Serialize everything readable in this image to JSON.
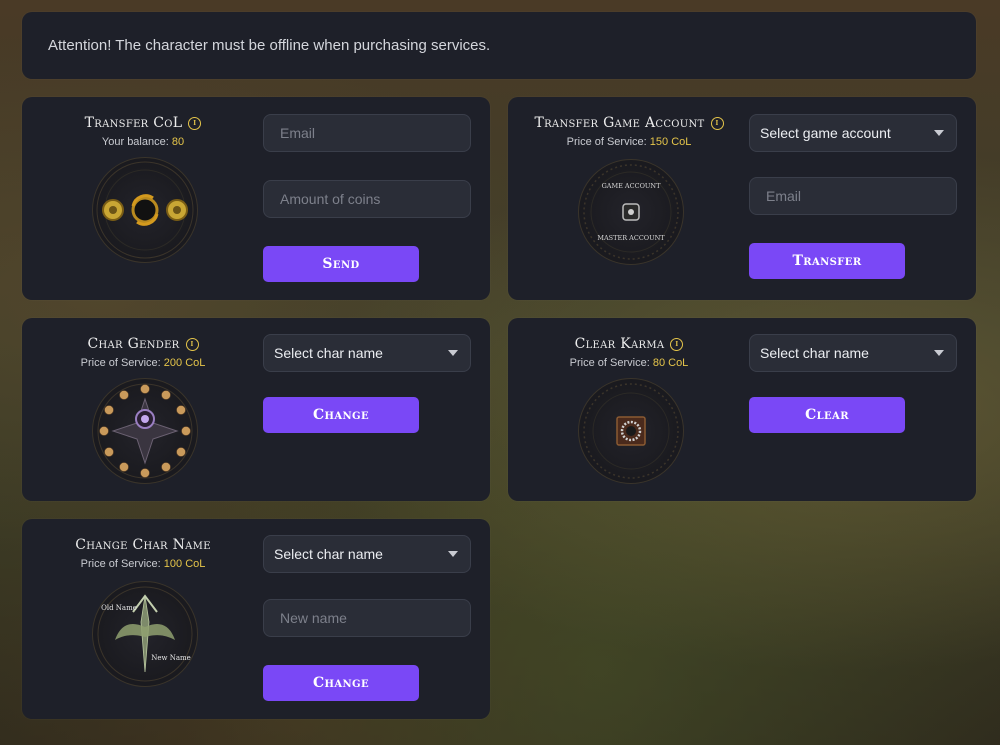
{
  "notice": {
    "text": "Attention! The character must be offline when purchasing services."
  },
  "transfer_col": {
    "title": "Transfer CoL",
    "balance_label": "Your balance:",
    "balance_value": "80",
    "email_placeholder": "Email",
    "amount_placeholder": "Amount of coins",
    "button": "Send"
  },
  "transfer_account": {
    "title": "Transfer Game Account",
    "price_label": "Price of Service:",
    "price_value": "150 CoL",
    "select_value": "Select game account",
    "email_placeholder": "Email",
    "emblem_top": "GAME ACCOUNT",
    "emblem_bottom": "MASTER ACCOUNT",
    "button": "Transfer"
  },
  "char_gender": {
    "title": "Char Gender",
    "price_label": "Price of Service:",
    "price_value": "200 CoL",
    "select_value": "Select char name",
    "button": "Change"
  },
  "clear_karma": {
    "title": "Clear Karma",
    "price_label": "Price of Service:",
    "price_value": "80 CoL",
    "select_value": "Select char name",
    "button": "Clear"
  },
  "change_name": {
    "title": "Change Char Name",
    "price_label": "Price of Service:",
    "price_value": "100 CoL",
    "select_value": "Select char name",
    "name_placeholder": "New name",
    "emblem_old": "Old Name",
    "emblem_new": "New Name",
    "button": "Change"
  },
  "colors": {
    "accent": "#7a48f6",
    "gold": "#e5c54a",
    "card": "#1e2029"
  },
  "icons": [
    "info-icon",
    "coin-transfer-icon",
    "account-transfer-icon",
    "gender-wheel-icon",
    "karma-icon",
    "name-change-icon",
    "chevron-down-icon"
  ]
}
